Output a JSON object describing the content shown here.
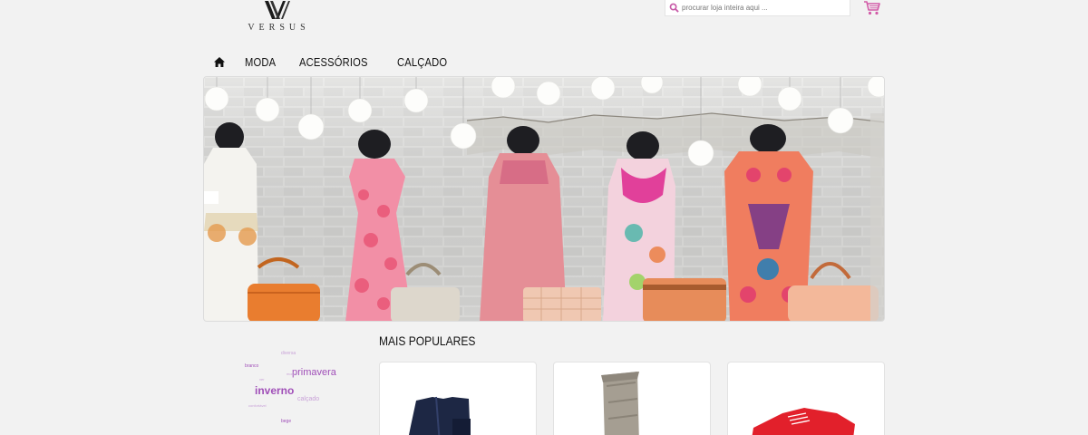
{
  "brand": {
    "name": "VERSUS",
    "logo_icon": "vx-monogram-icon"
  },
  "search": {
    "placeholder": "procurar loja inteira aqui ...",
    "icon": "search-icon"
  },
  "cart": {
    "icon": "cart-icon"
  },
  "nav": {
    "home_icon": "home-icon",
    "items": [
      {
        "label": "MODA"
      },
      {
        "label": "ACESSÓRIOS"
      },
      {
        "label": "CALÇADO"
      }
    ]
  },
  "tag_cloud": [
    {
      "label": "diversa"
    },
    {
      "label": "branco"
    },
    {
      "label": "primavera"
    },
    {
      "label": "inverno"
    },
    {
      "label": "calçado"
    },
    {
      "label": "confortável"
    },
    {
      "label": "bege"
    },
    {
      "label": "ver"
    },
    {
      "label": "moda"
    }
  ],
  "popular": {
    "title": "MAIS POPULARES",
    "products": [
      {
        "name": "navy-ankle-boot"
      },
      {
        "name": "grey-tall-boot"
      },
      {
        "name": "red-sneaker"
      }
    ]
  },
  "colors": {
    "accent": "#c85aa8",
    "tag_purple": "#a04fb8",
    "tag_light": "#c9a3d8",
    "background": "#f2f2f2"
  }
}
